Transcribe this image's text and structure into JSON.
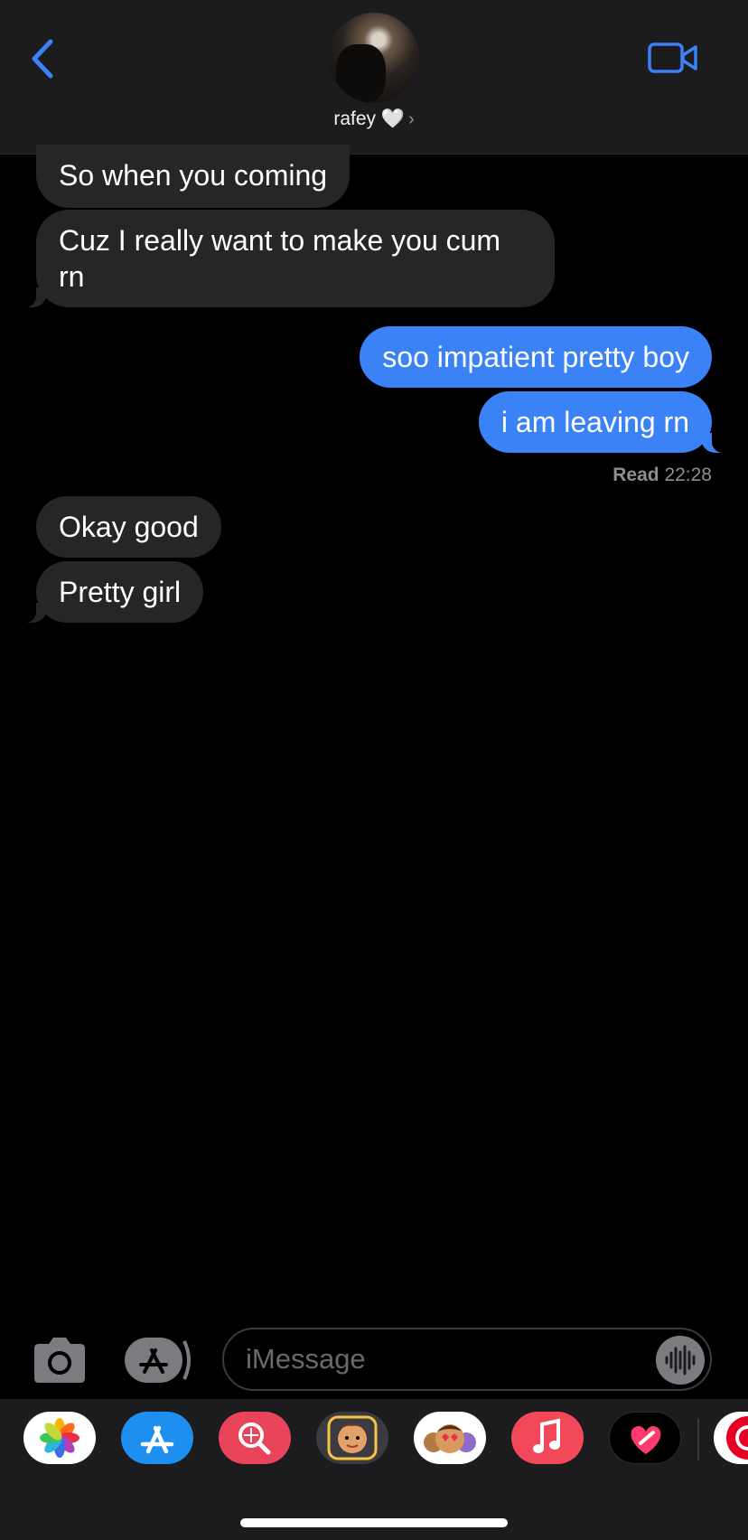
{
  "header": {
    "contact_name": "rafey 🤍",
    "chevron": "›",
    "back_icon": "chevron-left-icon",
    "video_icon": "video-camera-icon",
    "accent_color": "#3a82f6"
  },
  "messages": [
    {
      "side": "received",
      "text": "So when you coming"
    },
    {
      "side": "received",
      "text": "Cuz I really want to make you cum rn"
    },
    {
      "side": "sent",
      "text": "soo impatient pretty boy"
    },
    {
      "side": "sent",
      "text": "i am leaving rn"
    },
    {
      "side": "received",
      "text": "Okay good"
    },
    {
      "side": "received",
      "text": "Pretty girl"
    }
  ],
  "read_receipt": {
    "label": "Read",
    "time": "22:28"
  },
  "composer": {
    "placeholder": "iMessage",
    "camera_icon": "camera-icon",
    "apps_icon": "app-store-icon",
    "audio_icon": "audio-waveform-icon"
  },
  "app_drawer": [
    {
      "name": "Photos",
      "icon": "photos-icon"
    },
    {
      "name": "App Store",
      "icon": "app-store-icon"
    },
    {
      "name": "Search",
      "icon": "web-search-icon"
    },
    {
      "name": "Memoji",
      "icon": "memoji-icon"
    },
    {
      "name": "Memoji Stickers",
      "icon": "memoji-stickers-icon"
    },
    {
      "name": "Music",
      "icon": "music-icon"
    },
    {
      "name": "Digital Touch",
      "icon": "digital-touch-icon"
    },
    {
      "name": "Pinterest",
      "icon": "pinterest-icon"
    }
  ]
}
